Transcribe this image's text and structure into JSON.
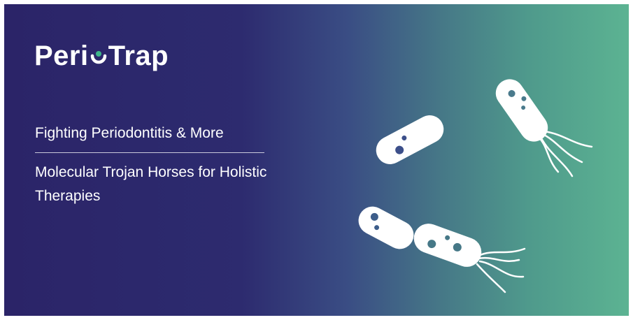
{
  "brand": {
    "name_part1": "Peri",
    "name_part2": "Trap"
  },
  "headline": "Fighting Periodontitis & More",
  "subline": "Molecular Trojan Horses for Holistic Therapies",
  "colors": {
    "gradient_start": "#2b2468",
    "gradient_end": "#5cb392",
    "text": "#ffffff",
    "accent": "#3fb58a"
  },
  "icons": [
    "bacterium-icon"
  ]
}
